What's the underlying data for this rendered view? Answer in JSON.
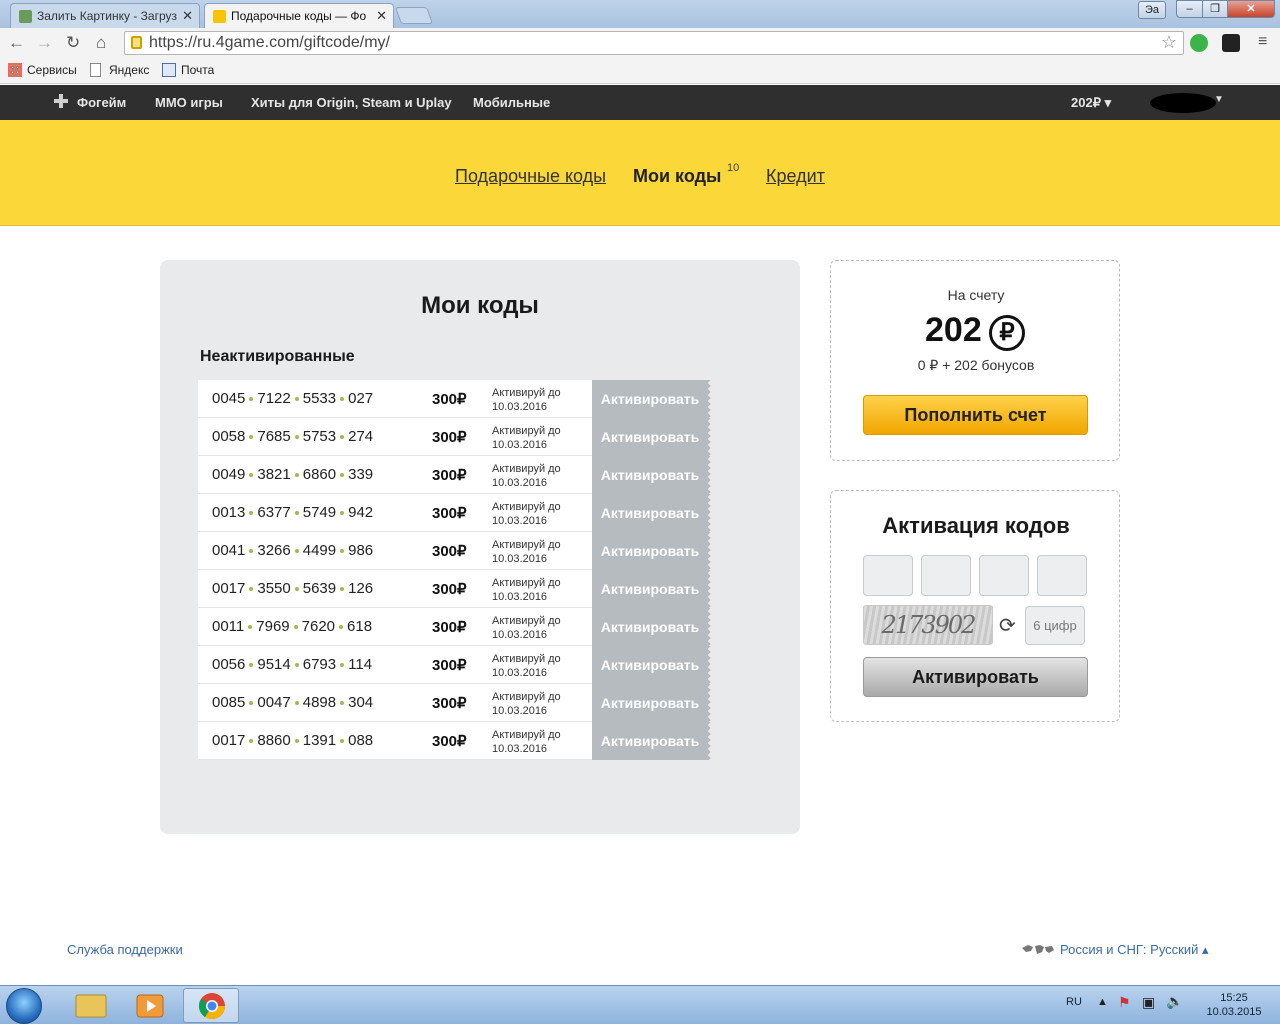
{
  "browser": {
    "tabs": [
      {
        "title": "Залить Картинку - Загруз"
      },
      {
        "title": "Подарочные коды — Фо"
      }
    ],
    "window_buttons": {
      "lang": "Эа"
    },
    "url": "https://ru.4game.com/giftcode/my/",
    "bookmarks": [
      {
        "label": "Сервисы"
      },
      {
        "label": "Яндекс"
      },
      {
        "label": "Почта"
      }
    ]
  },
  "sitenav": {
    "brand": "Фогейм",
    "items": [
      "MMO игры",
      "Хиты для Origin, Steam и Uplay",
      "Мобильные"
    ],
    "balance": "202₽ ▾"
  },
  "tabs": {
    "gift_codes": "Подарочные коды",
    "my_codes": "Мои коды",
    "my_codes_count": "10",
    "credit": "Кредит"
  },
  "codes_panel": {
    "title": "Мои коды",
    "section": "Неактивированные",
    "expires_label": "Активируй до",
    "activate_label": "Активировать",
    "codes": [
      {
        "parts": [
          "0045",
          "7122",
          "5533",
          "027"
        ],
        "price": "300₽",
        "date": "10.03.2016"
      },
      {
        "parts": [
          "0058",
          "7685",
          "5753",
          "274"
        ],
        "price": "300₽",
        "date": "10.03.2016"
      },
      {
        "parts": [
          "0049",
          "3821",
          "6860",
          "339"
        ],
        "price": "300₽",
        "date": "10.03.2016"
      },
      {
        "parts": [
          "0013",
          "6377",
          "5749",
          "942"
        ],
        "price": "300₽",
        "date": "10.03.2016"
      },
      {
        "parts": [
          "0041",
          "3266",
          "4499",
          "986"
        ],
        "price": "300₽",
        "date": "10.03.2016"
      },
      {
        "parts": [
          "0017",
          "3550",
          "5639",
          "126"
        ],
        "price": "300₽",
        "date": "10.03.2016"
      },
      {
        "parts": [
          "0011",
          "7969",
          "7620",
          "618"
        ],
        "price": "300₽",
        "date": "10.03.2016"
      },
      {
        "parts": [
          "0056",
          "9514",
          "6793",
          "114"
        ],
        "price": "300₽",
        "date": "10.03.2016"
      },
      {
        "parts": [
          "0085",
          "0047",
          "4898",
          "304"
        ],
        "price": "300₽",
        "date": "10.03.2016"
      },
      {
        "parts": [
          "0017",
          "8860",
          "1391",
          "088"
        ],
        "price": "300₽",
        "date": "10.03.2016"
      }
    ]
  },
  "balance": {
    "label": "На счету",
    "amount": "202",
    "currency_symbol": "₽",
    "breakdown": "0 ₽  + 202 бонусов",
    "topup_label": "Пополнить счет"
  },
  "activation": {
    "title": "Активация кодов",
    "captcha_text": "2173902",
    "captcha_placeholder": "6 цифр",
    "button_label": "Активировать"
  },
  "footer": {
    "support": "Служба поддержки",
    "region": "Россия и СНГ: Русский ▴"
  },
  "taskbar": {
    "lang": "RU",
    "time": "15:25",
    "date": "10.03.2015"
  },
  "colors": {
    "accent_yellow": "#fbd73a",
    "nav_dark": "#2f2f2f",
    "button_orange": "#f2a600",
    "disabled_grey": "#b6bbbf",
    "link_blue": "#3a6aa8"
  }
}
